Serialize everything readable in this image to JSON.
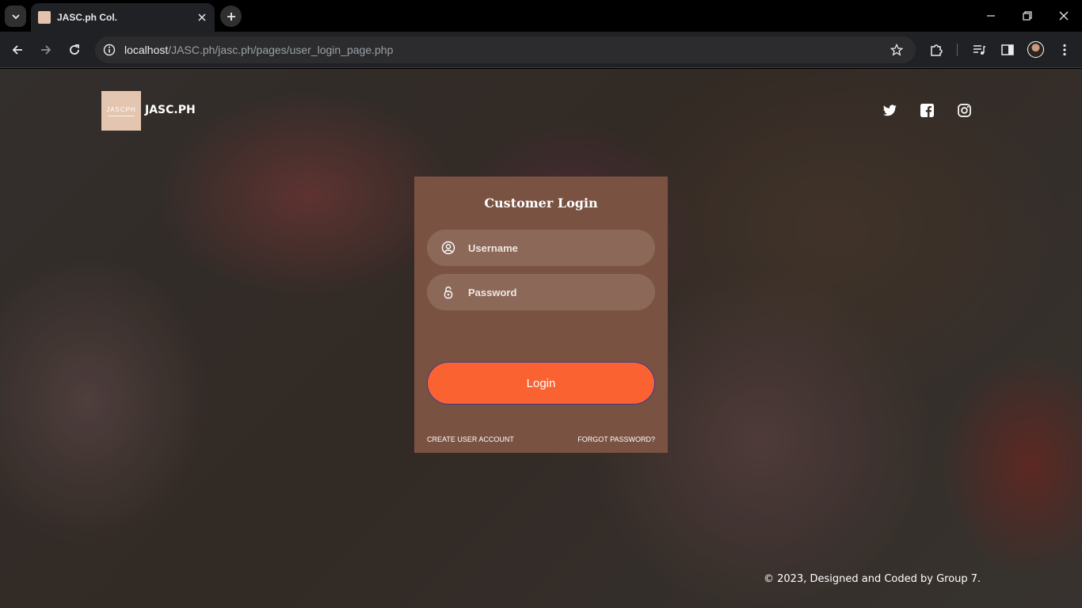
{
  "browser": {
    "tab_title": "JASC.ph Col.",
    "url_host": "localhost",
    "url_path": "/JASC.ph/jasc.ph/pages/user_login_page.php"
  },
  "header": {
    "logo_text": "JASCPH",
    "brand_name": "JASC.PH",
    "social": [
      "twitter-icon",
      "facebook-icon",
      "instagram-icon"
    ]
  },
  "login": {
    "title": "Customer Login",
    "username_placeholder": "Username",
    "password_placeholder": "Password",
    "login_label": "Login",
    "create_account_label": "CREATE USER ACCOUNT",
    "forgot_password_label": "FORGOT PASSWORD?"
  },
  "footer": {
    "text": "© 2023, Designed and Coded by Group 7."
  },
  "colors": {
    "card": "#7a5242",
    "field": "#8c6859",
    "button": "#fa6232",
    "logo_bg": "#e3c5b0"
  }
}
